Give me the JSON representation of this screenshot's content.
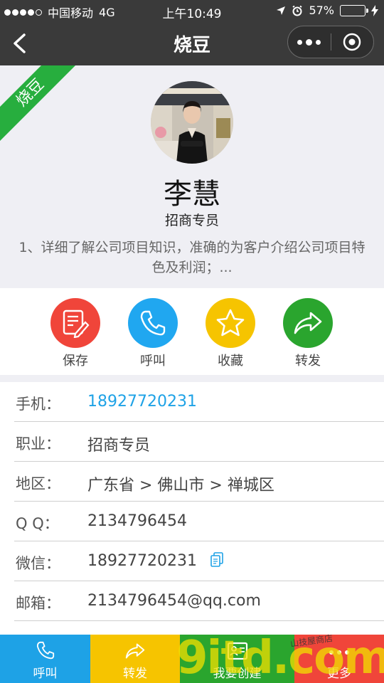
{
  "status_bar": {
    "carrier": "中国移动",
    "network": "4G",
    "time": "上午10:49",
    "battery_percent": "57%",
    "battery_level": 0.57
  },
  "nav": {
    "title": "烧豆",
    "back_icon": "chevron-left-icon",
    "more_icon": "more-dots-icon",
    "close_icon": "target-close-icon"
  },
  "profile": {
    "ribbon": "烧豆",
    "name": "李慧",
    "position": "招商专员",
    "intro": "1、详细了解公司项目知识，准确的为客户介绍公司项目特色及利润；..."
  },
  "actions": [
    {
      "label": "保存",
      "icon": "note-edit-icon",
      "color": "#f0453a"
    },
    {
      "label": "呼叫",
      "icon": "phone-icon",
      "color": "#20a7f0"
    },
    {
      "label": "收藏",
      "icon": "star-icon",
      "color": "#f6c400"
    },
    {
      "label": "转发",
      "icon": "share-arrow-icon",
      "color": "#2aa52e"
    }
  ],
  "info": {
    "mobile": {
      "label": "手机：",
      "value": "18927720231"
    },
    "job": {
      "label": "职业：",
      "value": "招商专员"
    },
    "region": {
      "label": "地区：",
      "value": "广东省 > 佛山市 > 禅城区"
    },
    "qq": {
      "label": "Q Q：",
      "value": "2134796454"
    },
    "wechat": {
      "label": "微信：",
      "value": "18927720231"
    },
    "email": {
      "label": "邮箱：",
      "value": "2134796454@qq.com"
    }
  },
  "bottom_bar": [
    {
      "label": "呼叫",
      "icon": "phone-icon",
      "color": "#1ea2e6"
    },
    {
      "label": "转发",
      "icon": "share-arrow-icon",
      "color": "#f6c400"
    },
    {
      "label": "我要创建",
      "icon": "card-icon",
      "color": "#2aa52e"
    },
    {
      "label": "更多",
      "icon": "more-dots-icon",
      "color": "#f0453a"
    }
  ],
  "watermark": {
    "main": "9itd.com",
    "sub": "山技屋商店"
  }
}
